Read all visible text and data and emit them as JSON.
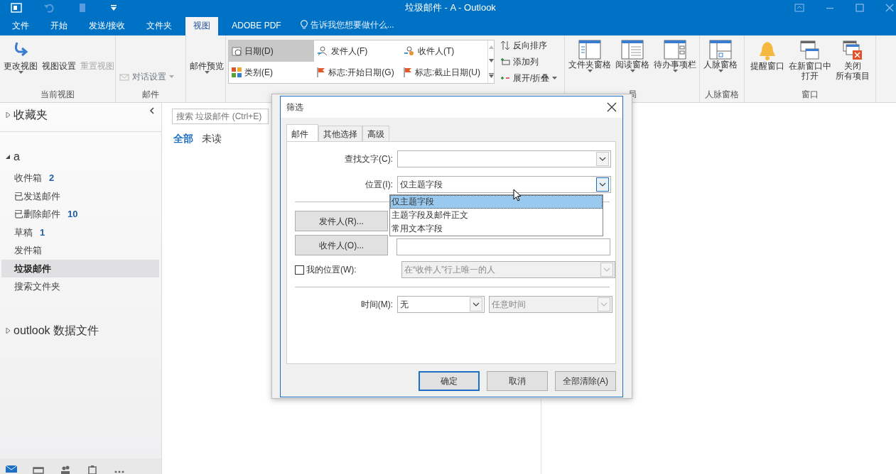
{
  "window": {
    "title": "垃圾邮件 - A - Outlook"
  },
  "menu_tabs": [
    {
      "label": "文件",
      "selected": false
    },
    {
      "label": "开始",
      "selected": false
    },
    {
      "label": "发送/接收",
      "selected": false
    },
    {
      "label": "文件夹",
      "selected": false
    },
    {
      "label": "视图",
      "selected": true
    },
    {
      "label": "ADOBE PDF",
      "selected": false
    }
  ],
  "tell_me": {
    "placeholder": "告诉我您想要做什么..."
  },
  "ribbon": {
    "current_view": {
      "label": "当前视图",
      "buttons": [
        {
          "label": "更改视图",
          "disabled": false
        },
        {
          "label": "视图设置",
          "disabled": false
        },
        {
          "label": "重置视图",
          "disabled": true
        }
      ]
    },
    "mail": {
      "label": "邮件",
      "buttons": [
        {
          "label": "对话设置",
          "disabled": true
        }
      ]
    },
    "preview": {
      "label": "邮件预览"
    },
    "arrangement": {
      "options": [
        {
          "label": "日期(D)",
          "selected": true
        },
        {
          "label": "发件人(F)",
          "selected": false
        },
        {
          "label": "收件人(T)",
          "selected": false
        },
        {
          "label": "类别(E)",
          "selected": false
        },
        {
          "label": "标志:开始日期(G)",
          "selected": false
        },
        {
          "label": "标志:截止日期(U)",
          "selected": false
        }
      ],
      "commands": [
        {
          "label": "反向排序"
        },
        {
          "label": "添加列"
        },
        {
          "label": "展开/折叠"
        }
      ]
    },
    "layout": {
      "label": "局",
      "buttons": [
        {
          "label": "文件夹窗格"
        },
        {
          "label": "阅读窗格"
        },
        {
          "label": "待办事项栏"
        }
      ]
    },
    "people": {
      "label": "人脉窗格",
      "buttons": [
        {
          "label": "人脉窗格"
        }
      ]
    },
    "window_group": {
      "label": "窗口",
      "buttons": [
        {
          "lines": [
            "提醒窗口"
          ]
        },
        {
          "lines": [
            "在新窗口中",
            "打开"
          ]
        },
        {
          "lines": [
            "关闭",
            "所有项目"
          ]
        }
      ]
    }
  },
  "sidebar": {
    "sections": [
      {
        "label": "收藏夹",
        "expanded": false
      },
      {
        "label": "a",
        "expanded": true,
        "children": [
          {
            "label": "收件箱",
            "count": "2",
            "selected": false
          },
          {
            "label": "已发送邮件",
            "selected": false
          },
          {
            "label": "已删除邮件",
            "count": "10",
            "selected": false
          },
          {
            "label": "草稿",
            "count": "1",
            "selected": false
          },
          {
            "label": "发件箱",
            "selected": false
          },
          {
            "label": "垃圾邮件",
            "selected": true
          },
          {
            "label": "搜索文件夹",
            "selected": false
          }
        ]
      },
      {
        "label": "outlook 数据文件",
        "expanded": false
      }
    ],
    "bottom_nav": [
      {
        "kind": "mail",
        "selected": true
      },
      {
        "kind": "calendar",
        "selected": false
      },
      {
        "kind": "people",
        "selected": false
      },
      {
        "kind": "tasks",
        "selected": false
      },
      {
        "kind": "more",
        "selected": false
      }
    ]
  },
  "message_list": {
    "search": {
      "placeholder": "搜索 垃圾邮件 (Ctrl+E)"
    },
    "filters": [
      {
        "label": "全部",
        "selected": true
      },
      {
        "label": "未读",
        "selected": false
      }
    ]
  },
  "dialog": {
    "title": "筛选",
    "tabs": [
      {
        "label": "邮件",
        "selected": true
      },
      {
        "label": "其他选择",
        "selected": false
      },
      {
        "label": "高级",
        "selected": false
      }
    ],
    "find_text": {
      "label": "查找文字(C):"
    },
    "location": {
      "label": "位置(I):",
      "value": "仅主题字段",
      "expanded": true,
      "options": [
        {
          "label": "仅主题字段",
          "selected": true
        },
        {
          "label": "主题字段及邮件正文",
          "selected": false
        },
        {
          "label": "常用文本字段",
          "selected": false
        }
      ]
    },
    "sender_button": "发件人(R)...",
    "recipient_button": "收件人(O)...",
    "my_location": {
      "label": "我的位置(W):",
      "checked": false,
      "value": "在“收件人”行上唯一的人",
      "disabled": true
    },
    "time": {
      "label": "时间(M):",
      "value": "无",
      "range": {
        "value": "任意时间",
        "disabled": true
      }
    },
    "buttons": [
      {
        "label": "确定",
        "default": true
      },
      {
        "label": "取消",
        "default": false
      },
      {
        "label": "全部清除(A)",
        "default": false
      }
    ]
  }
}
